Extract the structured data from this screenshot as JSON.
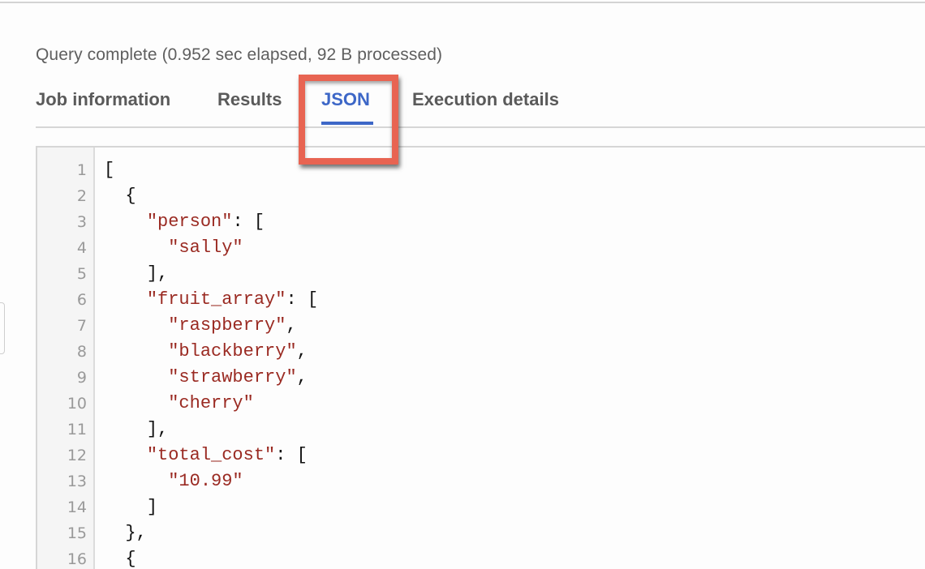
{
  "status": {
    "text": "Query complete (0.952 sec elapsed, 92 B processed)"
  },
  "tabs": [
    {
      "label": "Job information",
      "active": false
    },
    {
      "label": "Results",
      "active": false
    },
    {
      "label": "JSON",
      "active": true
    },
    {
      "label": "Execution details",
      "active": false
    }
  ],
  "colors": {
    "active_tab": "#3d67c7",
    "highlight_box": "#e86452",
    "json_string": "#9a2a22",
    "json_punct": "#111111",
    "line_number": "#999999"
  },
  "editor": {
    "lines": [
      {
        "n": "1",
        "indent": "",
        "parts": [
          {
            "t": "[",
            "s": false
          }
        ]
      },
      {
        "n": "2",
        "indent": "  ",
        "parts": [
          {
            "t": "{",
            "s": false
          }
        ]
      },
      {
        "n": "3",
        "indent": "    ",
        "parts": [
          {
            "t": "\"person\"",
            "s": true
          },
          {
            "t": ": [",
            "s": false
          }
        ]
      },
      {
        "n": "4",
        "indent": "      ",
        "parts": [
          {
            "t": "\"sally\"",
            "s": true
          }
        ]
      },
      {
        "n": "5",
        "indent": "    ",
        "parts": [
          {
            "t": "],",
            "s": false
          }
        ]
      },
      {
        "n": "6",
        "indent": "    ",
        "parts": [
          {
            "t": "\"fruit_array\"",
            "s": true
          },
          {
            "t": ": [",
            "s": false
          }
        ]
      },
      {
        "n": "7",
        "indent": "      ",
        "parts": [
          {
            "t": "\"raspberry\"",
            "s": true
          },
          {
            "t": ",",
            "s": false
          }
        ]
      },
      {
        "n": "8",
        "indent": "      ",
        "parts": [
          {
            "t": "\"blackberry\"",
            "s": true
          },
          {
            "t": ",",
            "s": false
          }
        ]
      },
      {
        "n": "9",
        "indent": "      ",
        "parts": [
          {
            "t": "\"strawberry\"",
            "s": true
          },
          {
            "t": ",",
            "s": false
          }
        ]
      },
      {
        "n": "10",
        "indent": "      ",
        "parts": [
          {
            "t": "\"cherry\"",
            "s": true
          }
        ]
      },
      {
        "n": "11",
        "indent": "    ",
        "parts": [
          {
            "t": "],",
            "s": false
          }
        ]
      },
      {
        "n": "12",
        "indent": "    ",
        "parts": [
          {
            "t": "\"total_cost\"",
            "s": true
          },
          {
            "t": ": [",
            "s": false
          }
        ]
      },
      {
        "n": "13",
        "indent": "      ",
        "parts": [
          {
            "t": "\"10.99\"",
            "s": true
          }
        ]
      },
      {
        "n": "14",
        "indent": "    ",
        "parts": [
          {
            "t": "]",
            "s": false
          }
        ]
      },
      {
        "n": "15",
        "indent": "  ",
        "parts": [
          {
            "t": "},",
            "s": false
          }
        ]
      },
      {
        "n": "16",
        "indent": "  ",
        "parts": [
          {
            "t": "{",
            "s": false
          }
        ]
      }
    ]
  }
}
